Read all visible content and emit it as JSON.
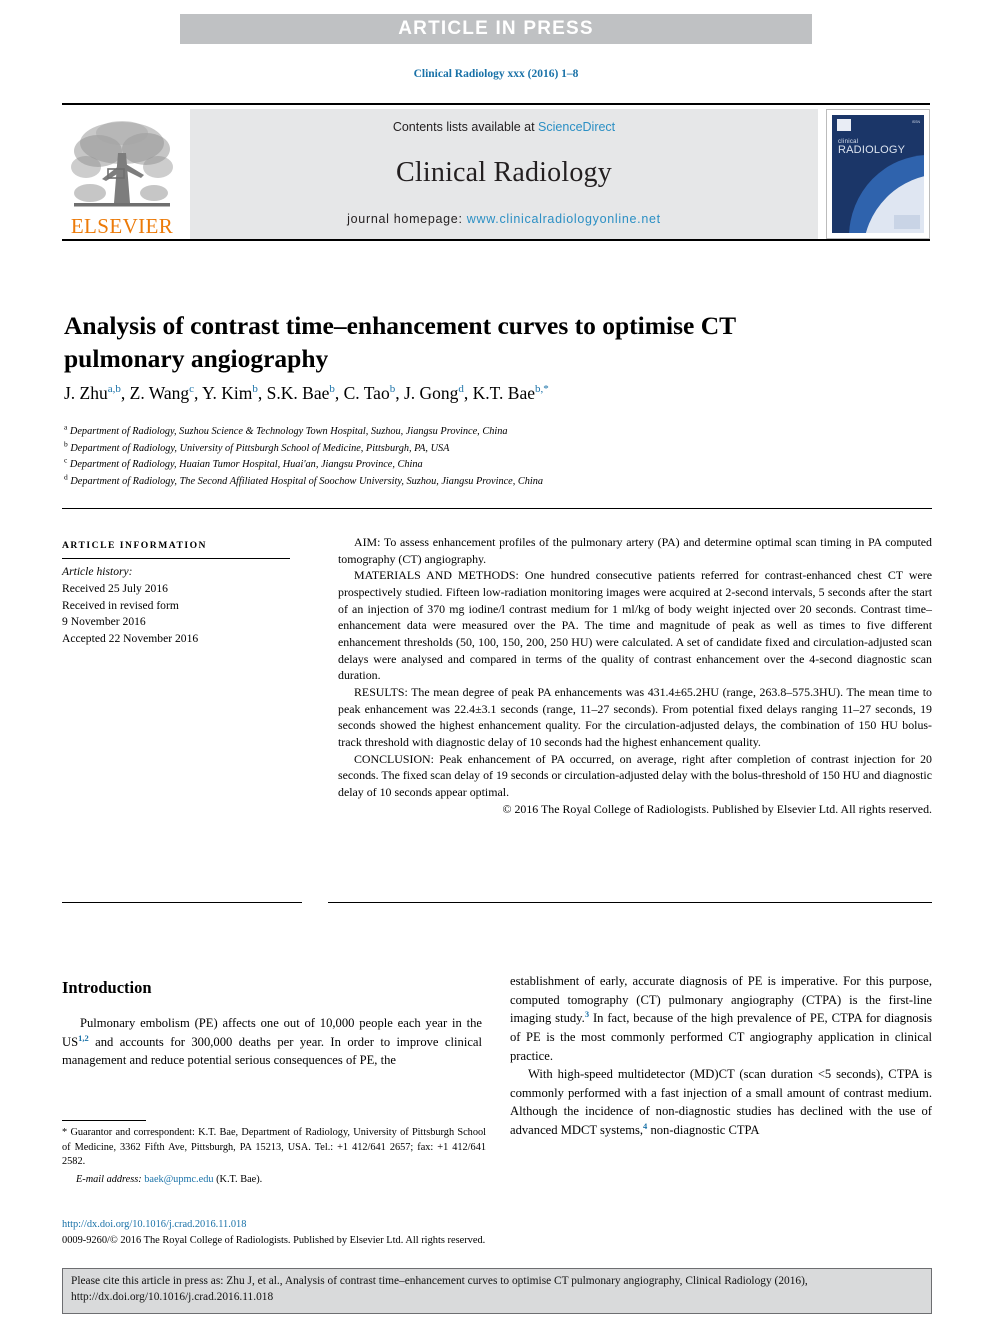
{
  "banner": {
    "text": "ARTICLE IN PRESS"
  },
  "running_head": {
    "journal_ref": "Clinical Radiology xxx (2016) 1–8",
    "link_color": "#1a72a8"
  },
  "masthead": {
    "publisher_logo_label": "ELSEVIER",
    "contents_prefix": "Contents lists available at ",
    "contents_link": "ScienceDirect",
    "journal_name": "Clinical Radiology",
    "homepage_prefix": "journal homepage: ",
    "homepage_url": "www.clinicalradiologyonline.net",
    "cover": {
      "line1": "clinical",
      "line2": "RADIOLOGY"
    },
    "accent_color": "#2b8fc4",
    "panel_color": "#e6e7e8",
    "elsevier_orange": "#ec7a08"
  },
  "article": {
    "title": "Analysis of contrast time–enhancement curves to optimise CT pulmonary angiography",
    "authors": [
      {
        "name": "J. Zhu",
        "marks": "a,b"
      },
      {
        "name": "Z. Wang",
        "marks": "c"
      },
      {
        "name": "Y. Kim",
        "marks": "b"
      },
      {
        "name": "S.K. Bae",
        "marks": "b"
      },
      {
        "name": "C. Tao",
        "marks": "b"
      },
      {
        "name": "J. Gong",
        "marks": "d"
      },
      {
        "name": "K.T. Bae",
        "marks": "b,*"
      }
    ],
    "affiliations": [
      {
        "mark": "a",
        "text": "Department of Radiology, Suzhou Science & Technology Town Hospital, Suzhou, Jiangsu Province, China"
      },
      {
        "mark": "b",
        "text": "Department of Radiology, University of Pittsburgh School of Medicine, Pittsburgh, PA, USA"
      },
      {
        "mark": "c",
        "text": "Department of Radiology, Huaian Tumor Hospital, Huai'an, Jiangsu Province, China"
      },
      {
        "mark": "d",
        "text": "Department of Radiology, The Second Affiliated Hospital of Soochow University, Suzhou, Jiangsu Province, China"
      }
    ]
  },
  "article_information": {
    "heading": "ARTICLE INFORMATION",
    "history_label": "Article history:",
    "history": [
      "Received 25 July 2016",
      "Received in revised form",
      "9 November 2016",
      "Accepted 22 November 2016"
    ]
  },
  "abstract": {
    "aim": "AIM: To assess enhancement profiles of the pulmonary artery (PA) and determine optimal scan timing in PA computed tomography (CT) angiography.",
    "materials": "MATERIALS AND METHODS: One hundred consecutive patients referred for contrast-enhanced chest CT were prospectively studied. Fifteen low-radiation monitoring images were acquired at 2-second intervals, 5 seconds after the start of an injection of 370 mg iodine/l contrast medium for 1 ml/kg of body weight injected over 20 seconds. Contrast time–enhancement data were measured over the PA. The time and magnitude of peak as well as times to five different enhancement thresholds (50, 100, 150, 200, 250 HU) were calculated. A set of candidate fixed and circulation-adjusted scan delays were analysed and compared in terms of the quality of contrast enhancement over the 4-second diagnostic scan duration.",
    "results": "RESULTS: The mean degree of peak PA enhancements was 431.4±65.2HU (range, 263.8–575.3HU). The mean time to peak enhancement was 22.4±3.1 seconds (range, 11–27 seconds). From potential fixed delays ranging 11–27 seconds, 19 seconds showed the highest enhancement quality. For the circulation-adjusted delays, the combination of 150 HU bolus-track threshold with diagnostic delay of 10 seconds had the highest enhancement quality.",
    "conclusion": "CONCLUSION: Peak enhancement of PA occurred, on average, right after completion of contrast injection for 20 seconds. The fixed scan delay of 19 seconds or circulation-adjusted delay with the bolus-threshold of 150 HU and diagnostic delay of 10 seconds appear optimal.",
    "copyright": "© 2016 The Royal College of Radiologists. Published by Elsevier Ltd. All rights reserved."
  },
  "introduction": {
    "heading": "Introduction",
    "left_paragraph": "Pulmonary embolism (PE) affects one out of 10,000 people each year in the US",
    "left_ref_1": "1,2",
    "left_paragraph_cont": " and accounts for 300,000 deaths per year. In order to improve clinical management and reduce potential serious consequences of PE, the",
    "right_paragraph_1a": "establishment of early, accurate diagnosis of PE is imperative. For this purpose, computed tomography (CT) pulmonary angiography (CTPA) is the first-line imaging study.",
    "right_ref_3": "3",
    "right_paragraph_1b": " In fact, because of the high prevalence of PE, CTPA for diagnosis of PE is the most commonly performed CT angiography application in clinical practice.",
    "right_paragraph_2a": "With high-speed multidetector (MD)CT (scan duration <5 seconds), CTPA is commonly performed with a fast injection of a small amount of contrast medium. Although the incidence of non-diagnostic studies has declined with the use of advanced MDCT systems,",
    "right_ref_4": "4",
    "right_paragraph_2b": " non-diagnostic CTPA"
  },
  "footnote": {
    "correspondence": "* Guarantor and correspondent: K.T. Bae, Department of Radiology, University of Pittsburgh School of Medicine, 3362 Fifth Ave, Pittsburgh, PA 15213, USA. Tel.: +1 412/641 2657; fax: +1 412/641 2582.",
    "email_label": "E-mail address:",
    "email": "baek@upmc.edu",
    "email_owner": "(K.T. Bae)."
  },
  "publication": {
    "doi": "http://dx.doi.org/10.1016/j.crad.2016.11.018",
    "issn_copyright": "0009-9260/© 2016 The Royal College of Radiologists. Published by Elsevier Ltd. All rights reserved."
  },
  "cite_box": {
    "text": "Please cite this article in press as: Zhu J, et al., Analysis of contrast time–enhancement curves to optimise CT pulmonary angiography, Clinical Radiology (2016), http://dx.doi.org/10.1016/j.crad.2016.11.018"
  }
}
